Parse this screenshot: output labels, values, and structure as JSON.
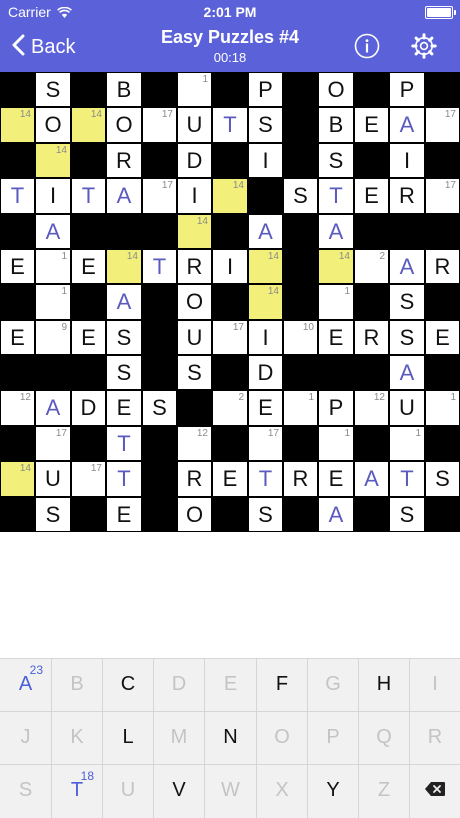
{
  "status_bar": {
    "carrier": "Carrier",
    "time": "2:01 PM"
  },
  "nav": {
    "back_label": "Back",
    "title": "Easy Puzzles #4",
    "timer": "00:18"
  },
  "colors": {
    "header": "#5b62d9",
    "highlight": "#f2f07a",
    "entered_letter": "#5b5bbf",
    "key_accent": "#4a5fd9"
  },
  "grid": {
    "rows": [
      [
        {
          "t": "b"
        },
        {
          "t": "w",
          "l": "S",
          "s": "g"
        },
        {
          "t": "b"
        },
        {
          "t": "w",
          "l": "B",
          "s": "g"
        },
        {
          "t": "b"
        },
        {
          "t": "w",
          "n": "1"
        },
        {
          "t": "b"
        },
        {
          "t": "w",
          "l": "P",
          "s": "g"
        },
        {
          "t": "b"
        },
        {
          "t": "w",
          "l": "O",
          "s": "g"
        },
        {
          "t": "b"
        },
        {
          "t": "w",
          "l": "P",
          "s": "g"
        },
        {
          "t": "b"
        }
      ],
      [
        {
          "t": "y",
          "n": "14"
        },
        {
          "t": "w",
          "l": "O",
          "s": "g"
        },
        {
          "t": "y",
          "n": "14"
        },
        {
          "t": "w",
          "l": "O",
          "s": "g"
        },
        {
          "t": "w",
          "n": "17"
        },
        {
          "t": "w",
          "l": "U",
          "s": "g"
        },
        {
          "t": "w",
          "l": "T",
          "s": "e"
        },
        {
          "t": "w",
          "l": "S",
          "s": "g"
        },
        {
          "t": "b"
        },
        {
          "t": "w",
          "l": "B",
          "s": "g"
        },
        {
          "t": "w",
          "l": "E",
          "s": "g"
        },
        {
          "t": "w",
          "l": "A",
          "s": "e"
        },
        {
          "t": "w",
          "n": "17"
        }
      ],
      [
        {
          "t": "b"
        },
        {
          "t": "y",
          "n": "14"
        },
        {
          "t": "b"
        },
        {
          "t": "w",
          "l": "R",
          "s": "g"
        },
        {
          "t": "b"
        },
        {
          "t": "w",
          "l": "D",
          "s": "g"
        },
        {
          "t": "b"
        },
        {
          "t": "w",
          "l": "I",
          "s": "g"
        },
        {
          "t": "b"
        },
        {
          "t": "w",
          "l": "S",
          "s": "g"
        },
        {
          "t": "b"
        },
        {
          "t": "w",
          "l": "I",
          "s": "g"
        },
        {
          "t": "b"
        }
      ],
      [
        {
          "t": "w",
          "l": "T",
          "s": "e"
        },
        {
          "t": "w",
          "l": "I",
          "s": "g"
        },
        {
          "t": "w",
          "l": "T",
          "s": "e"
        },
        {
          "t": "w",
          "l": "A",
          "s": "e"
        },
        {
          "t": "w",
          "n": "17"
        },
        {
          "t": "w",
          "l": "I",
          "s": "g"
        },
        {
          "t": "y",
          "n": "14"
        },
        {
          "t": "b"
        },
        {
          "t": "w",
          "l": "S",
          "s": "g"
        },
        {
          "t": "w",
          "l": "T",
          "s": "e"
        },
        {
          "t": "w",
          "l": "E",
          "s": "g"
        },
        {
          "t": "w",
          "l": "R",
          "s": "g"
        },
        {
          "t": "w",
          "n": "17"
        }
      ],
      [
        {
          "t": "b"
        },
        {
          "t": "w",
          "l": "A",
          "s": "e"
        },
        {
          "t": "b"
        },
        {
          "t": "b"
        },
        {
          "t": "b"
        },
        {
          "t": "y",
          "n": "14"
        },
        {
          "t": "b"
        },
        {
          "t": "w",
          "l": "A",
          "s": "e"
        },
        {
          "t": "b"
        },
        {
          "t": "w",
          "l": "A",
          "s": "e"
        },
        {
          "t": "b"
        },
        {
          "t": "b"
        },
        {
          "t": "b"
        }
      ],
      [
        {
          "t": "w",
          "l": "E",
          "s": "g"
        },
        {
          "t": "w",
          "n": "1"
        },
        {
          "t": "w",
          "l": "E",
          "s": "g"
        },
        {
          "t": "y",
          "n": "14"
        },
        {
          "t": "w",
          "l": "T",
          "s": "e"
        },
        {
          "t": "w",
          "l": "R",
          "s": "g"
        },
        {
          "t": "w",
          "l": "I",
          "s": "g"
        },
        {
          "t": "y",
          "n": "14"
        },
        {
          "t": "b"
        },
        {
          "t": "y",
          "n": "14"
        },
        {
          "t": "w",
          "n": "2"
        },
        {
          "t": "w",
          "l": "A",
          "s": "e"
        },
        {
          "t": "w",
          "l": "R",
          "s": "g"
        }
      ],
      [
        {
          "t": "b"
        },
        {
          "t": "w",
          "n": "1"
        },
        {
          "t": "b"
        },
        {
          "t": "w",
          "l": "A",
          "s": "e"
        },
        {
          "t": "b"
        },
        {
          "t": "w",
          "l": "O",
          "s": "g"
        },
        {
          "t": "b"
        },
        {
          "t": "y",
          "n": "14"
        },
        {
          "t": "b"
        },
        {
          "t": "w",
          "n": "1"
        },
        {
          "t": "b"
        },
        {
          "t": "w",
          "l": "S",
          "s": "g"
        },
        {
          "t": "b"
        }
      ],
      [
        {
          "t": "w",
          "l": "E",
          "s": "g"
        },
        {
          "t": "w",
          "n": "9"
        },
        {
          "t": "w",
          "l": "E",
          "s": "g"
        },
        {
          "t": "w",
          "l": "S",
          "s": "g"
        },
        {
          "t": "b"
        },
        {
          "t": "w",
          "l": "U",
          "s": "g"
        },
        {
          "t": "w",
          "n": "17"
        },
        {
          "t": "w",
          "l": "I",
          "s": "g"
        },
        {
          "t": "w",
          "n": "10"
        },
        {
          "t": "w",
          "l": "E",
          "s": "g"
        },
        {
          "t": "w",
          "l": "R",
          "s": "g"
        },
        {
          "t": "w",
          "l": "S",
          "s": "g"
        },
        {
          "t": "w",
          "l": "E",
          "s": "g"
        }
      ],
      [
        {
          "t": "b"
        },
        {
          "t": "b"
        },
        {
          "t": "b"
        },
        {
          "t": "w",
          "l": "S",
          "s": "g"
        },
        {
          "t": "b"
        },
        {
          "t": "w",
          "l": "S",
          "s": "g"
        },
        {
          "t": "b"
        },
        {
          "t": "w",
          "l": "D",
          "s": "g"
        },
        {
          "t": "b"
        },
        {
          "t": "b"
        },
        {
          "t": "b"
        },
        {
          "t": "w",
          "l": "A",
          "s": "e"
        },
        {
          "t": "b"
        }
      ],
      [
        {
          "t": "w",
          "n": "12"
        },
        {
          "t": "w",
          "l": "A",
          "s": "e"
        },
        {
          "t": "w",
          "l": "D",
          "s": "g"
        },
        {
          "t": "w",
          "l": "E",
          "s": "g"
        },
        {
          "t": "w",
          "l": "S",
          "s": "g"
        },
        {
          "t": "b"
        },
        {
          "t": "w",
          "n": "2"
        },
        {
          "t": "w",
          "l": "E",
          "s": "g"
        },
        {
          "t": "w",
          "n": "1"
        },
        {
          "t": "w",
          "l": "P",
          "s": "g"
        },
        {
          "t": "w",
          "n": "12"
        },
        {
          "t": "w",
          "l": "U",
          "s": "g"
        },
        {
          "t": "w",
          "n": "1"
        }
      ],
      [
        {
          "t": "b"
        },
        {
          "t": "w",
          "n": "17"
        },
        {
          "t": "b"
        },
        {
          "t": "w",
          "l": "T",
          "s": "e"
        },
        {
          "t": "b"
        },
        {
          "t": "w",
          "n": "12"
        },
        {
          "t": "b"
        },
        {
          "t": "w",
          "n": "17"
        },
        {
          "t": "b"
        },
        {
          "t": "w",
          "n": "1"
        },
        {
          "t": "b"
        },
        {
          "t": "w",
          "n": "1"
        },
        {
          "t": "b"
        }
      ],
      [
        {
          "t": "y",
          "n": "14"
        },
        {
          "t": "w",
          "l": "U",
          "s": "g"
        },
        {
          "t": "w",
          "n": "17"
        },
        {
          "t": "w",
          "l": "T",
          "s": "e"
        },
        {
          "t": "b"
        },
        {
          "t": "w",
          "l": "R",
          "s": "g"
        },
        {
          "t": "w",
          "l": "E",
          "s": "g"
        },
        {
          "t": "w",
          "l": "T",
          "s": "e"
        },
        {
          "t": "w",
          "l": "R",
          "s": "g"
        },
        {
          "t": "w",
          "l": "E",
          "s": "g"
        },
        {
          "t": "w",
          "l": "A",
          "s": "e"
        },
        {
          "t": "w",
          "l": "T",
          "s": "e"
        },
        {
          "t": "w",
          "l": "S",
          "s": "g"
        }
      ],
      [
        {
          "t": "b"
        },
        {
          "t": "w",
          "l": "S",
          "s": "g"
        },
        {
          "t": "b"
        },
        {
          "t": "w",
          "l": "E",
          "s": "g"
        },
        {
          "t": "b"
        },
        {
          "t": "w",
          "l": "O",
          "s": "g"
        },
        {
          "t": "b"
        },
        {
          "t": "w",
          "l": "S",
          "s": "g"
        },
        {
          "t": "b"
        },
        {
          "t": "w",
          "l": "A",
          "s": "e"
        },
        {
          "t": "b"
        },
        {
          "t": "w",
          "l": "S",
          "s": "g"
        },
        {
          "t": "b"
        }
      ]
    ]
  },
  "keyboard": {
    "rows": [
      [
        {
          "l": "A",
          "state": "accent",
          "count": "23"
        },
        {
          "l": "B",
          "state": "disabled"
        },
        {
          "l": "C",
          "state": "normal"
        },
        {
          "l": "D",
          "state": "disabled"
        },
        {
          "l": "E",
          "state": "disabled"
        },
        {
          "l": "F",
          "state": "normal"
        },
        {
          "l": "G",
          "state": "disabled"
        },
        {
          "l": "H",
          "state": "normal"
        },
        {
          "l": "I",
          "state": "disabled"
        }
      ],
      [
        {
          "l": "J",
          "state": "disabled"
        },
        {
          "l": "K",
          "state": "disabled"
        },
        {
          "l": "L",
          "state": "normal"
        },
        {
          "l": "M",
          "state": "disabled"
        },
        {
          "l": "N",
          "state": "normal"
        },
        {
          "l": "O",
          "state": "disabled"
        },
        {
          "l": "P",
          "state": "disabled"
        },
        {
          "l": "Q",
          "state": "disabled"
        },
        {
          "l": "R",
          "state": "disabled"
        }
      ],
      [
        {
          "l": "S",
          "state": "disabled"
        },
        {
          "l": "T",
          "state": "accent",
          "count": "18"
        },
        {
          "l": "U",
          "state": "disabled"
        },
        {
          "l": "V",
          "state": "normal"
        },
        {
          "l": "W",
          "state": "disabled"
        },
        {
          "l": "X",
          "state": "disabled"
        },
        {
          "l": "Y",
          "state": "normal"
        },
        {
          "l": "Z",
          "state": "disabled"
        },
        {
          "l": "backspace",
          "icon": "backspace-icon",
          "state": "normal"
        }
      ]
    ]
  }
}
